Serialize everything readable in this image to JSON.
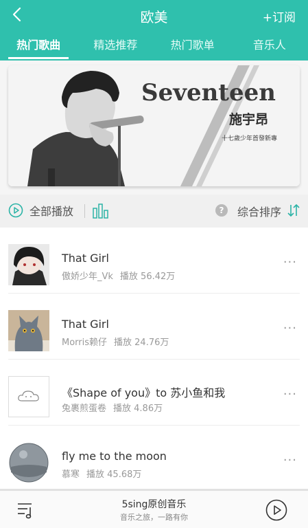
{
  "header": {
    "title": "欧美",
    "subscribe_label": "+订阅",
    "tabs": [
      {
        "label": "热门歌曲",
        "active": true
      },
      {
        "label": "精选推荐",
        "active": false
      },
      {
        "label": "热门歌单",
        "active": false
      },
      {
        "label": "音乐人",
        "active": false
      }
    ]
  },
  "banner": {
    "title": "Seventeen",
    "artist": "施宇昂",
    "subtitle": "十七歲少年首發新專"
  },
  "controls": {
    "play_all_label": "全部播放",
    "sort_label": "综合排序",
    "help_glyph": "?"
  },
  "songs": [
    {
      "title": "That Girl",
      "artist": "傲娇少年_Vk",
      "plays": "播放 56.42万",
      "thumb": "anime-portrait"
    },
    {
      "title": "That Girl",
      "artist": "Morris赖仔",
      "plays": "播放 24.76万",
      "thumb": "grey-cat"
    },
    {
      "title": "《Shape of you》to 苏小鱼和我",
      "artist": "兔裹煎蛋卷",
      "plays": "播放 4.86万",
      "thumb": "cloud-face"
    },
    {
      "title": "fly me to the moon",
      "artist": "慕寒",
      "plays": "播放 45.68万",
      "thumb": "moon-disc"
    }
  ],
  "player": {
    "name": "5sing原创音乐",
    "subtitle": "音乐之旅，一路有你"
  },
  "colors": {
    "accent": "#2fc0ad",
    "icon_teal": "#2ab3a6"
  },
  "more_glyph": "···"
}
